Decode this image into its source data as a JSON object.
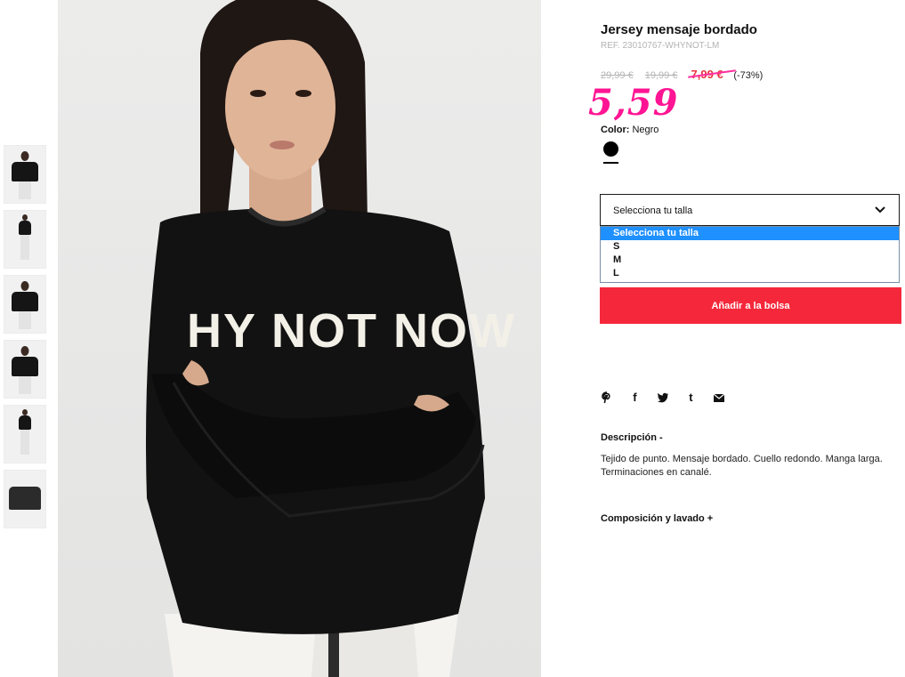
{
  "product": {
    "title": "Jersey mensaje bordado",
    "ref": "REF. 23010767-WHYNOT-LM",
    "price_original": "29,99 €",
    "price_previous": "19,99 €",
    "price_sale": "7,99 €",
    "discount": "(-73%)",
    "handwritten_price": "5,59",
    "sweater_text": "HY NOT NOW"
  },
  "color": {
    "label": "Color:",
    "value": "Negro",
    "swatch_hex": "#000000"
  },
  "size": {
    "select_label": "Selecciona tu talla",
    "options": [
      "Selecciona tu talla",
      "S",
      "M",
      "L"
    ],
    "selected_index": 0
  },
  "cart": {
    "add_label": "Añadir a la bolsa",
    "button_color": "#f5283b"
  },
  "share": {
    "icons": [
      "pinterest-icon",
      "facebook-icon",
      "twitter-icon",
      "tumblr-icon",
      "email-icon"
    ],
    "facebook_glyph": "f",
    "tumblr_glyph": "t"
  },
  "description": {
    "title": "Descripción -",
    "text": "Tejido de punto. Mensaje bordado. Cuello redondo. Manga larga. Terminaciones en canalé."
  },
  "composition": {
    "title": "Composición y lavado +"
  },
  "colors": {
    "accent_pink": "#ff1493",
    "sale_red": "#e8323c",
    "dropdown_highlight": "#1e90ff"
  }
}
